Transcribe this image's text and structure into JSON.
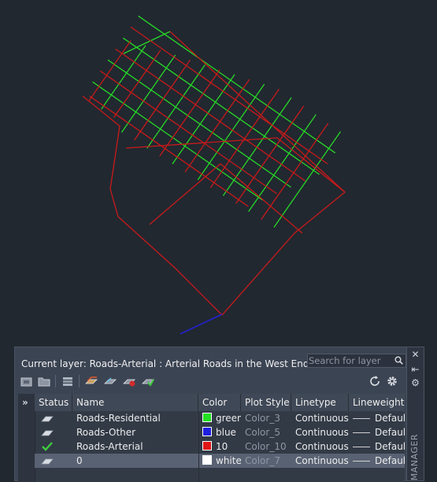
{
  "palette": {
    "current_layer": "Current layer: Roads-Arterial : Arterial Roads in the West End",
    "search_placeholder": "Search for layer",
    "side_title": "MANAGER",
    "expander": "»",
    "columns": [
      "Status",
      "Name",
      "Color",
      "Plot Style",
      "Linetype",
      "Lineweight"
    ],
    "layers": [
      {
        "name": "Roads-Residential",
        "color_name": "green",
        "color_hex": "#22e022",
        "plot_style": "Color_3",
        "linetype": "Continuous",
        "lineweight": "Default",
        "current": false,
        "selected": false
      },
      {
        "name": "Roads-Other",
        "color_name": "blue",
        "color_hex": "#1f1fe0",
        "plot_style": "Color_5",
        "linetype": "Continuous",
        "lineweight": "Default",
        "current": false,
        "selected": false
      },
      {
        "name": "Roads-Arterial",
        "color_name": "10",
        "color_hex": "#e01616",
        "plot_style": "Color_10",
        "linetype": "Continuous",
        "lineweight": "Default",
        "current": true,
        "selected": false
      },
      {
        "name": "0",
        "color_name": "white",
        "color_hex": "#ffffff",
        "plot_style": "Color_7",
        "linetype": "Continuous",
        "lineweight": "Default",
        "current": false,
        "selected": true
      }
    ]
  },
  "drawing_colors": {
    "residential": "#27d827",
    "arterial": "#c81a1a",
    "other": "#2222d0",
    "background": "#212830"
  }
}
